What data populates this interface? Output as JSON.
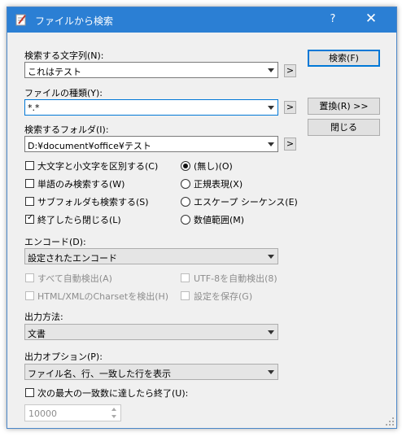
{
  "window": {
    "title": "ファイルから検索",
    "help": "?",
    "close": "✕"
  },
  "search_text": {
    "label": "検索する文字列(N):",
    "value": "これはテスト"
  },
  "file_type": {
    "label": "ファイルの種類(Y):",
    "value": "*.*"
  },
  "search_folder": {
    "label": "検索するフォルダ(I):",
    "value": "D:¥document¥office¥テスト"
  },
  "arrow_button": ">",
  "buttons": {
    "search": "検索(F)",
    "replace": "置換(R) >>",
    "close": "閉じる"
  },
  "options": [
    {
      "label": "大文字と小文字を区別する(C)",
      "checked": false
    },
    {
      "label": "単語のみ検索する(W)",
      "checked": false
    },
    {
      "label": "サブフォルダも検索する(S)",
      "checked": false
    },
    {
      "label": "終了したら閉じる(L)",
      "checked": true
    }
  ],
  "modes": [
    {
      "label": "(無し)(O)",
      "selected": true
    },
    {
      "label": "正規表現(X)",
      "selected": false
    },
    {
      "label": "エスケープ シーケンス(E)",
      "selected": false
    },
    {
      "label": "数値範囲(M)",
      "selected": false
    }
  ],
  "encode": {
    "label": "エンコード(D):",
    "value": "設定されたエンコード",
    "auto_detect": "すべて自動検出(A)",
    "utf8_detect": "UTF-8を自動検出(8)",
    "charset_detect": "HTML/XMLのCharsetを検出(H)",
    "save_setting": "設定を保存(G)"
  },
  "output_method": {
    "label": "出力方法:",
    "value": "文書"
  },
  "output_option": {
    "label": "出力オプション(P):",
    "value": "ファイル名、行、一致した行を表示"
  },
  "max_match": {
    "label": "次の最大の一致数に達したら終了(U):",
    "value": "10000",
    "checked": false
  },
  "colors": {
    "titlebar": "#2b7fd4",
    "accent": "#0078d7"
  }
}
